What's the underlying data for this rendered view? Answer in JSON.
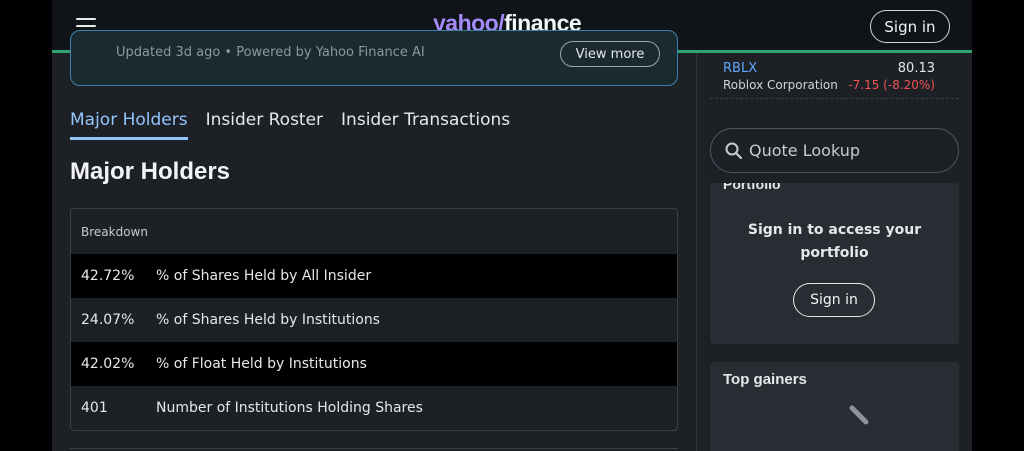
{
  "header": {
    "logo_yahoo": "yahoo/",
    "logo_finance": "finance",
    "signin_label": "Sign in",
    "accent_color": "#2ea46f"
  },
  "banner": {
    "text": "Updated 3d ago • Powered by Yahoo Finance AI",
    "view_more_label": "View more"
  },
  "tabs": [
    {
      "label": "Major Holders",
      "active": true
    },
    {
      "label": "Insider Roster",
      "active": false
    },
    {
      "label": "Insider Transactions",
      "active": false
    }
  ],
  "section_title": "Major Holders",
  "holders_table": {
    "header": "Breakdown",
    "rows": [
      {
        "value": "42.72%",
        "label": "% of Shares Held by All Insider"
      },
      {
        "value": "24.07%",
        "label": "% of Shares Held by Institutions"
      },
      {
        "value": "42.02%",
        "label": "% of Float Held by Institutions"
      },
      {
        "value": "401",
        "label": "Number of Institutions Holding Shares"
      }
    ]
  },
  "ticker": {
    "symbol": "RBLX",
    "price": "80.13",
    "name": "Roblox Corporation",
    "change": "-7.15 (-8.20%)",
    "change_color": "#f05252"
  },
  "quote_lookup": {
    "placeholder": "Quote Lookup"
  },
  "portfolio": {
    "heading": "Portfolio",
    "message": "Sign in to access your portfolio",
    "signin_label": "Sign in"
  },
  "top_gainers": {
    "heading": "Top gainers"
  }
}
